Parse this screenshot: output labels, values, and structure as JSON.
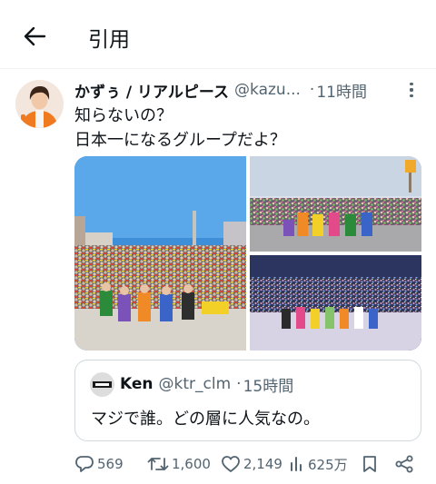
{
  "header": {
    "title": "引用",
    "back_icon": "arrow-left-icon"
  },
  "tweet": {
    "author": {
      "display_name": "かずぅ / リアルピース",
      "handle": "@kazu...",
      "avatar": "avatar"
    },
    "separator": "·",
    "time": "11時間",
    "more_icon": "more-vertical-icon",
    "text_lines": [
      "知らないの？",
      "日本一になるグループだよ？"
    ],
    "media": {
      "count": 3,
      "description_icons": [
        "photo-outdoor-crowd",
        "photo-stage-crowd",
        "photo-arena-crowd"
      ]
    }
  },
  "quoted_tweet": {
    "display_name": "Ken",
    "handle": "@ktr_clm",
    "separator": "·",
    "time": "15時間",
    "text": "マジで誰。どの層に人気なの。"
  },
  "actions": {
    "replies": "569",
    "retweets": "1,600",
    "likes": "2,149",
    "views": "625万",
    "icons": [
      "reply-icon",
      "retweet-icon",
      "like-icon",
      "views-icon",
      "bookmark-icon",
      "share-icon"
    ]
  },
  "colors": {
    "text": "#0f1419",
    "secondary": "#536471",
    "border": "#cfd9de"
  }
}
